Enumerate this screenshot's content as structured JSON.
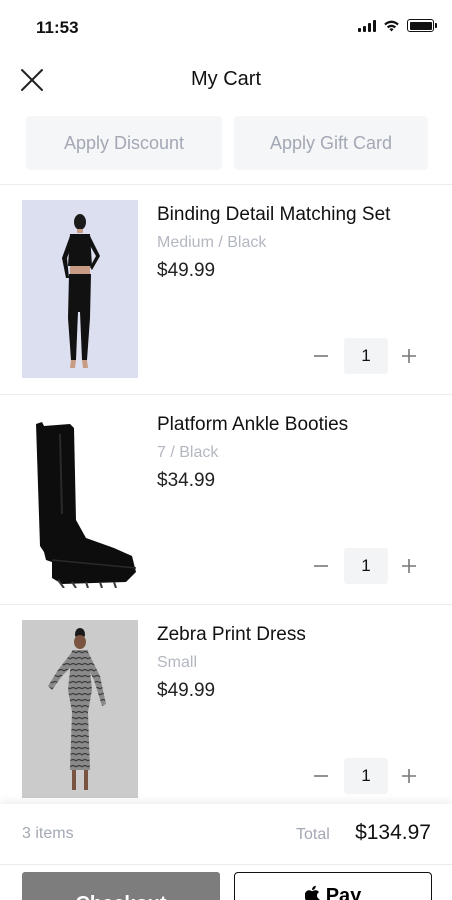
{
  "status_bar": {
    "time": "11:53"
  },
  "header": {
    "title": "My Cart"
  },
  "promos": {
    "discount_label": "Apply Discount",
    "gift_card_label": "Apply Gift Card"
  },
  "cart": {
    "items": [
      {
        "name": "Binding Detail Matching Set",
        "variant": "Medium / Black",
        "price": "$49.99",
        "quantity": "1"
      },
      {
        "name": "Platform Ankle Booties",
        "variant": "7 / Black",
        "price": "$34.99",
        "quantity": "1"
      },
      {
        "name": "Zebra Print Dress",
        "variant": "Small",
        "price": "$49.99",
        "quantity": "1"
      }
    ]
  },
  "summary": {
    "item_count": "3 items",
    "total_label": "Total",
    "total_value": "$134.97"
  },
  "actions": {
    "checkout_label": "Checkout",
    "apple_pay_label": "Pay"
  },
  "colors": {
    "accent_muted": "#a3a8b4",
    "button_bg": "#f5f6f8",
    "checkout_bg": "#7d7d7d"
  }
}
